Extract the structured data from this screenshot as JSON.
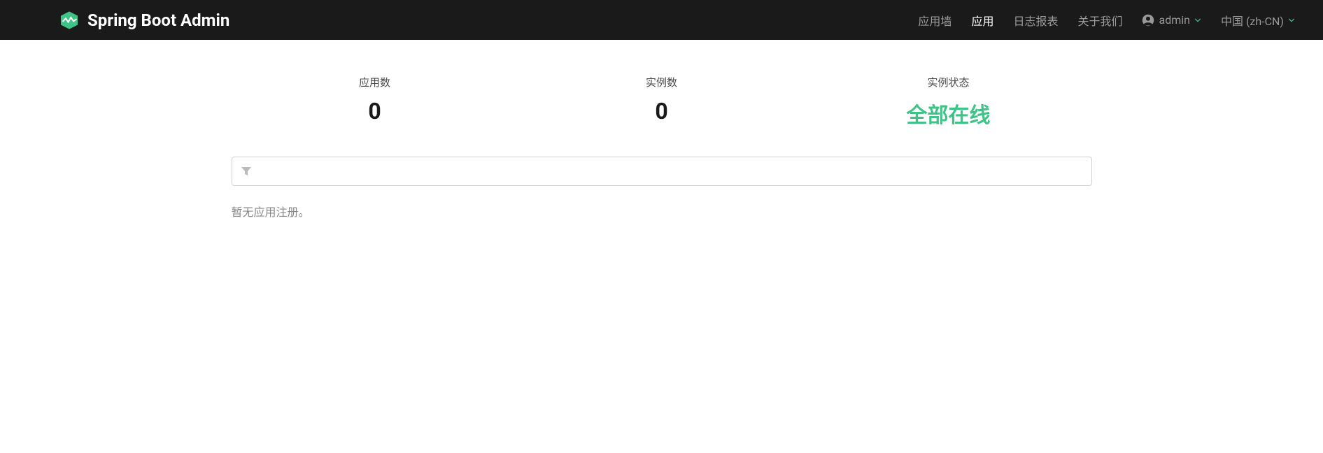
{
  "brand": {
    "title": "Spring Boot Admin"
  },
  "nav": {
    "items": [
      {
        "label": "应用墙",
        "active": false
      },
      {
        "label": "应用",
        "active": true
      },
      {
        "label": "日志报表",
        "active": false
      },
      {
        "label": "关于我们",
        "active": false
      }
    ],
    "user": {
      "label": "admin"
    },
    "locale": {
      "label": "中国 (zh-CN)"
    }
  },
  "stats": {
    "apps": {
      "label": "应用数",
      "value": "0"
    },
    "instances": {
      "label": "实例数",
      "value": "0"
    },
    "status": {
      "label": "实例状态",
      "value": "全部在线"
    }
  },
  "filter": {
    "placeholder": ""
  },
  "empty": {
    "message": "暂无应用注册。"
  },
  "colors": {
    "accent": "#3ec487",
    "navbar": "#1a1a1a"
  }
}
